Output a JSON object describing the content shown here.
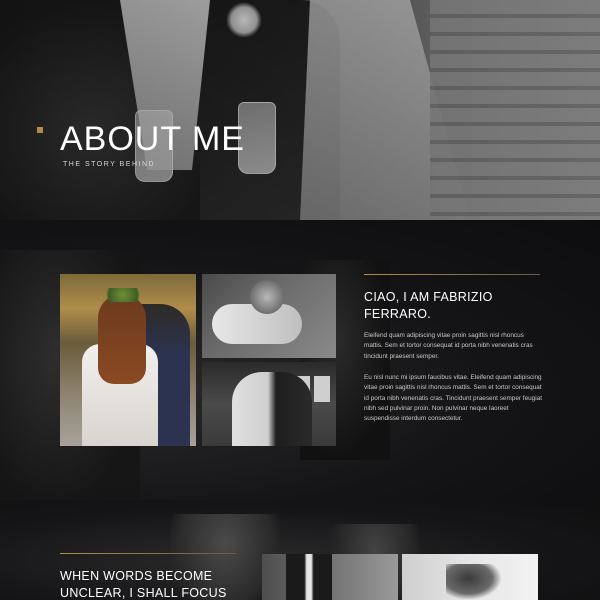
{
  "hero": {
    "title": "ABOUT ME",
    "subtitle": "THE STORY BEHIND"
  },
  "about": {
    "heading": "CIAO, I AM FABRIZIO FERRARO.",
    "paragraph_1": "Eleifend quam adipiscing vitae proin sagittis nisl rhoncus mattis. Sem et tortor consequat id porta nibh venenatis cras tincidunt praesent semper.",
    "paragraph_2": "Eu nisl nunc mi ipsum faucibus vitae. Eleifend quam adipiscing vitae proin sagittis nisl rhoncus mattis. Sem et tortor consequat id porta nibh venenatis cras. Tincidunt praesent semper feugiat nibh sed pulvinar proin. Non pulvinar neque laoreet suspendisse interdum consectetur."
  },
  "section2": {
    "heading": "WHEN WORDS BECOME UNCLEAR, I SHALL FOCUS"
  },
  "colors": {
    "accent": "#b48a4a",
    "background": "#0e0e10",
    "text_muted": "#c9c9c9"
  }
}
